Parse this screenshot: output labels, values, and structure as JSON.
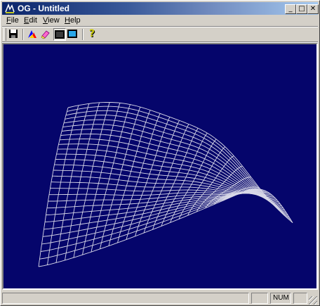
{
  "window": {
    "title": "OG - Untitled"
  },
  "title_buttons": {
    "minimize": "_",
    "maximize": "□",
    "close": "✕"
  },
  "menu": [
    {
      "label": "File",
      "mnemonic": "F",
      "rest": "ile"
    },
    {
      "label": "Edit",
      "mnemonic": "E",
      "rest": "dit"
    },
    {
      "label": "View",
      "mnemonic": "V",
      "rest": "iew"
    },
    {
      "label": "Help",
      "mnemonic": "H",
      "rest": "elp"
    }
  ],
  "toolbar": {
    "icons": [
      "save-icon",
      "color-palette-icon",
      "eraser-icon",
      "dark-monitor-icon",
      "light-monitor-icon",
      "help-icon"
    ],
    "pressed": "dark-monitor-icon",
    "help_glyph": "?"
  },
  "status": {
    "message": "",
    "indicator_empty": "",
    "num": "NUM"
  },
  "colors": {
    "viewport_bg": "#05056b",
    "mesh": "#d8d8e8",
    "titlebar_start": "#0a246a"
  }
}
